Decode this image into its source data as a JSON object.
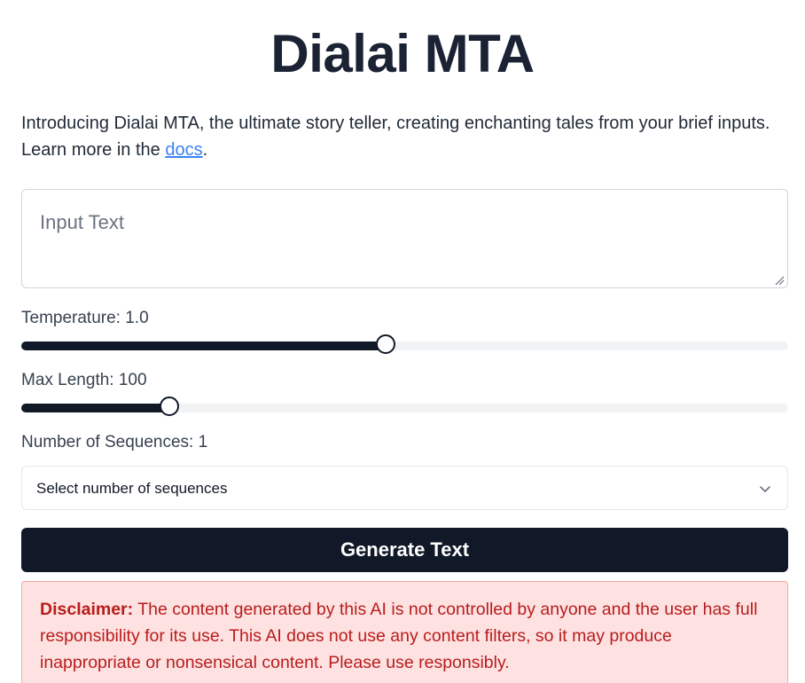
{
  "header": {
    "title": "Dialai MTA"
  },
  "intro": {
    "text_before": "Introducing Dialai MTA, the ultimate story teller, creating enchanting tales from your brief inputs. Learn more in the ",
    "docs_link": "docs",
    "text_after": "."
  },
  "input": {
    "placeholder": "Input Text",
    "value": ""
  },
  "temperature": {
    "label": "Temperature: 1.0",
    "value": 1.0,
    "fraction": 0.475
  },
  "max_length": {
    "label": "Max Length: 100",
    "value": 100,
    "fraction": 0.193
  },
  "sequences": {
    "label": "Number of Sequences: 1",
    "select_placeholder": "Select number of sequences"
  },
  "generate_button": {
    "label": "Generate Text"
  },
  "disclaimer": {
    "bold": "Disclaimer:",
    "text": " The content generated by this AI is not controlled by anyone and the user has full responsibility for its use. This AI does not use any content filters, so it may produce inappropriate or nonsensical content. Please use responsibly."
  },
  "colors": {
    "primary": "#111827",
    "link": "#3b82f6",
    "disclaimer_bg": "#fee2e2",
    "disclaimer_text": "#b91c1c"
  },
  "icons": {
    "select_chevron": "chevron-down-icon",
    "textarea_resize": "resize-grip-icon"
  }
}
